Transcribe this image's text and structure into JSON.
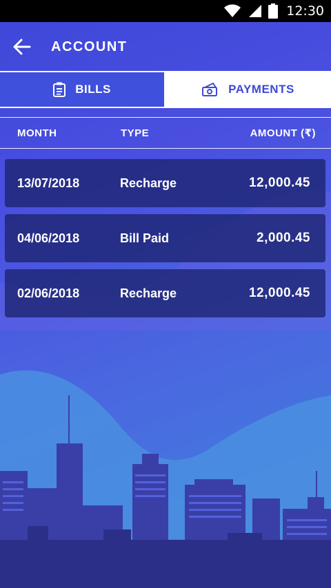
{
  "status_bar": {
    "time": "12:30"
  },
  "app_bar": {
    "title": "ACCOUNT"
  },
  "tabs": [
    {
      "label": "BILLS",
      "icon": "clipboard-icon",
      "selected": false
    },
    {
      "label": "PAYMENTS",
      "icon": "money-icon",
      "selected": true
    }
  ],
  "table": {
    "headers": {
      "month": "MONTH",
      "type": "TYPE",
      "amount": "AMOUNT (₹)"
    },
    "rows": [
      {
        "date": "13/07/2018",
        "type": "Recharge",
        "amount": "12,000.45"
      },
      {
        "date": "04/06/2018",
        "type": "Bill Paid",
        "amount": "2,000.45"
      },
      {
        "date": "02/06/2018",
        "type": "Recharge",
        "amount": "12,000.45"
      }
    ]
  },
  "colors": {
    "accent": "#3f48d6",
    "row_background": "#1c246e",
    "tab_active_bg": "#ffffff"
  }
}
